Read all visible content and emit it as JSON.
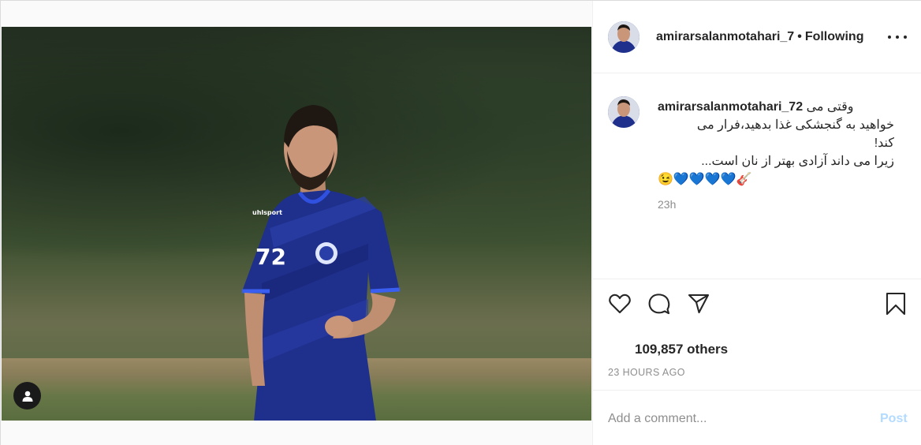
{
  "post": {
    "username": "amirarsalanmotahari_7",
    "follow_label": "Following",
    "caption": {
      "username": "amirarsalanmotahari_72",
      "lines": [
        "وقتی می",
        "خواهید به گنجشکی غذا بدهید،فرار می",
        "کند!",
        "زیرا می داند آزادی بهتر از نان است..."
      ],
      "emoji": "😉💙💙💙💙🎸",
      "time": "23h"
    },
    "likes_text": "109,857 others",
    "posted_ago": "23 HOURS AGO",
    "comment": {
      "placeholder": "Add a comment...",
      "post_label": "Post"
    },
    "photo": {
      "jersey_number": "72",
      "jersey_brand": "uhlsport"
    },
    "icons": {
      "like": "heart-icon",
      "comment": "comment-icon",
      "share": "share-icon",
      "save": "bookmark-icon",
      "more": "more-icon",
      "user_tag": "user-tag-icon"
    },
    "colors": {
      "post_button_disabled": "#b3dbff",
      "secondary_text": "#8e8e8e",
      "jersey_blue": "#1f2f8c"
    }
  }
}
